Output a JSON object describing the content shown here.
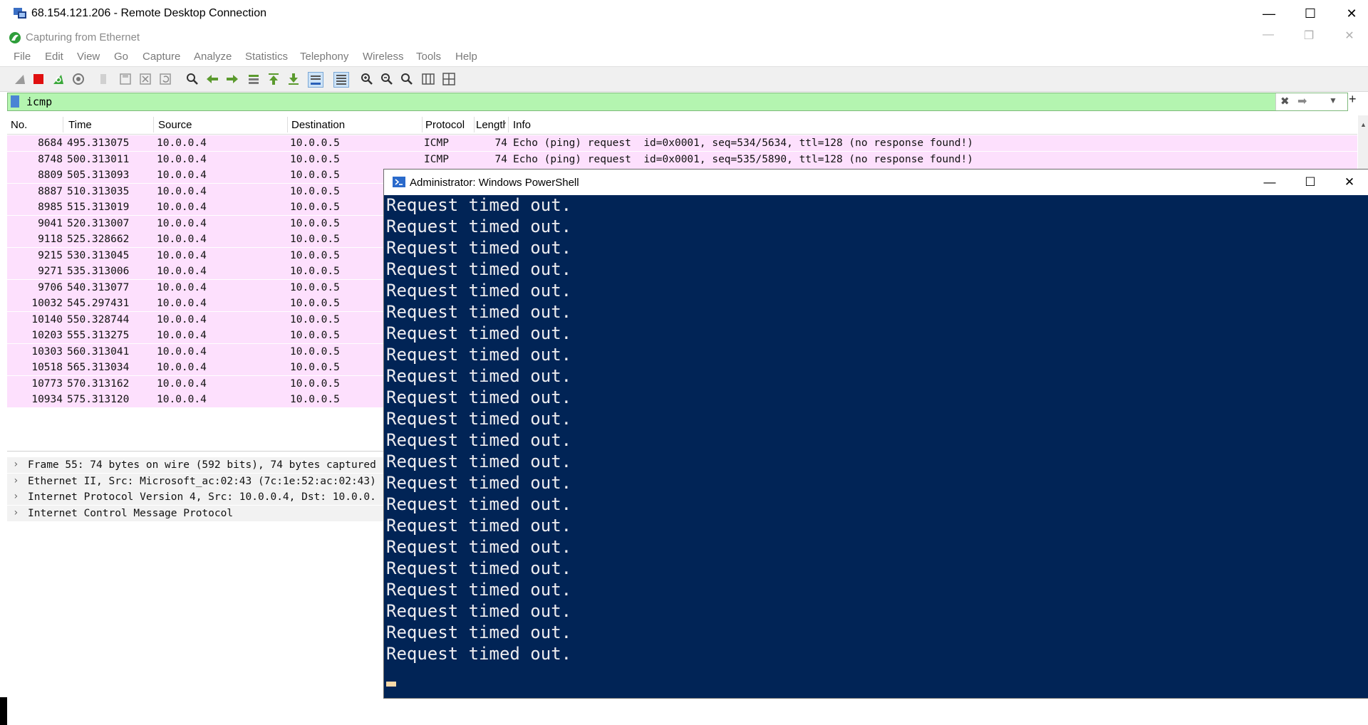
{
  "rdp": {
    "title": "68.154.121.206 - Remote Desktop Connection",
    "minimize": "—",
    "maximize": "☐",
    "close": "✕"
  },
  "wireshark": {
    "title": "Capturing from Ethernet",
    "menu": [
      "File",
      "Edit",
      "View",
      "Go",
      "Capture",
      "Analyze",
      "Statistics",
      "Telephony",
      "Wireless",
      "Tools",
      "Help"
    ],
    "filter": {
      "value": "icmp"
    },
    "columns": [
      "No.",
      "Time",
      "Source",
      "Destination",
      "Protocol",
      "Length",
      "Info"
    ],
    "packets": [
      {
        "no": "8684",
        "time": "495.313075",
        "src": "10.0.0.4",
        "dst": "10.0.0.5",
        "proto": "ICMP",
        "len": "74",
        "info": "Echo (ping) request  id=0x0001, seq=534/5634, ttl=128 (no response found!)"
      },
      {
        "no": "8748",
        "time": "500.313011",
        "src": "10.0.0.4",
        "dst": "10.0.0.5",
        "proto": "ICMP",
        "len": "74",
        "info": "Echo (ping) request  id=0x0001, seq=535/5890, ttl=128 (no response found!)"
      },
      {
        "no": "8809",
        "time": "505.313093",
        "src": "10.0.0.4",
        "dst": "10.0.0.5",
        "proto": "",
        "len": "",
        "info": ""
      },
      {
        "no": "8887",
        "time": "510.313035",
        "src": "10.0.0.4",
        "dst": "10.0.0.5",
        "proto": "",
        "len": "",
        "info": ""
      },
      {
        "no": "8985",
        "time": "515.313019",
        "src": "10.0.0.4",
        "dst": "10.0.0.5",
        "proto": "",
        "len": "",
        "info": ""
      },
      {
        "no": "9041",
        "time": "520.313007",
        "src": "10.0.0.4",
        "dst": "10.0.0.5",
        "proto": "",
        "len": "",
        "info": ""
      },
      {
        "no": "9118",
        "time": "525.328662",
        "src": "10.0.0.4",
        "dst": "10.0.0.5",
        "proto": "",
        "len": "",
        "info": ""
      },
      {
        "no": "9215",
        "time": "530.313045",
        "src": "10.0.0.4",
        "dst": "10.0.0.5",
        "proto": "",
        "len": "",
        "info": ""
      },
      {
        "no": "9271",
        "time": "535.313006",
        "src": "10.0.0.4",
        "dst": "10.0.0.5",
        "proto": "",
        "len": "",
        "info": ""
      },
      {
        "no": "9706",
        "time": "540.313077",
        "src": "10.0.0.4",
        "dst": "10.0.0.5",
        "proto": "",
        "len": "",
        "info": ""
      },
      {
        "no": "10032",
        "time": "545.297431",
        "src": "10.0.0.4",
        "dst": "10.0.0.5",
        "proto": "",
        "len": "",
        "info": ""
      },
      {
        "no": "10140",
        "time": "550.328744",
        "src": "10.0.0.4",
        "dst": "10.0.0.5",
        "proto": "",
        "len": "",
        "info": ""
      },
      {
        "no": "10203",
        "time": "555.313275",
        "src": "10.0.0.4",
        "dst": "10.0.0.5",
        "proto": "",
        "len": "",
        "info": ""
      },
      {
        "no": "10303",
        "time": "560.313041",
        "src": "10.0.0.4",
        "dst": "10.0.0.5",
        "proto": "",
        "len": "",
        "info": ""
      },
      {
        "no": "10518",
        "time": "565.313034",
        "src": "10.0.0.4",
        "dst": "10.0.0.5",
        "proto": "",
        "len": "",
        "info": ""
      },
      {
        "no": "10773",
        "time": "570.313162",
        "src": "10.0.0.4",
        "dst": "10.0.0.5",
        "proto": "",
        "len": "",
        "info": ""
      },
      {
        "no": "10934",
        "time": "575.313120",
        "src": "10.0.0.4",
        "dst": "10.0.0.5",
        "proto": "",
        "len": "",
        "info": ""
      }
    ],
    "details": [
      "Frame 55: 74 bytes on wire (592 bits), 74 bytes captured",
      "Ethernet II, Src: Microsoft_ac:02:43 (7c:1e:52:ac:02:43)",
      "Internet Protocol Version 4, Src: 10.0.0.4, Dst: 10.0.0.",
      "Internet Control Message Protocol"
    ],
    "row_color": "#fde0fd",
    "filter_color": "#b4f5b0"
  },
  "powershell": {
    "title": "Administrator: Windows PowerShell",
    "lines": [
      "Request timed out.",
      "Request timed out.",
      "Request timed out.",
      "Request timed out.",
      "Request timed out.",
      "Request timed out.",
      "Request timed out.",
      "Request timed out.",
      "Request timed out.",
      "Request timed out.",
      "Request timed out.",
      "Request timed out.",
      "Request timed out.",
      "Request timed out.",
      "Request timed out.",
      "Request timed out.",
      "Request timed out.",
      "Request timed out.",
      "Request timed out.",
      "Request timed out.",
      "Request timed out.",
      "Request timed out."
    ],
    "background": "#012456"
  }
}
